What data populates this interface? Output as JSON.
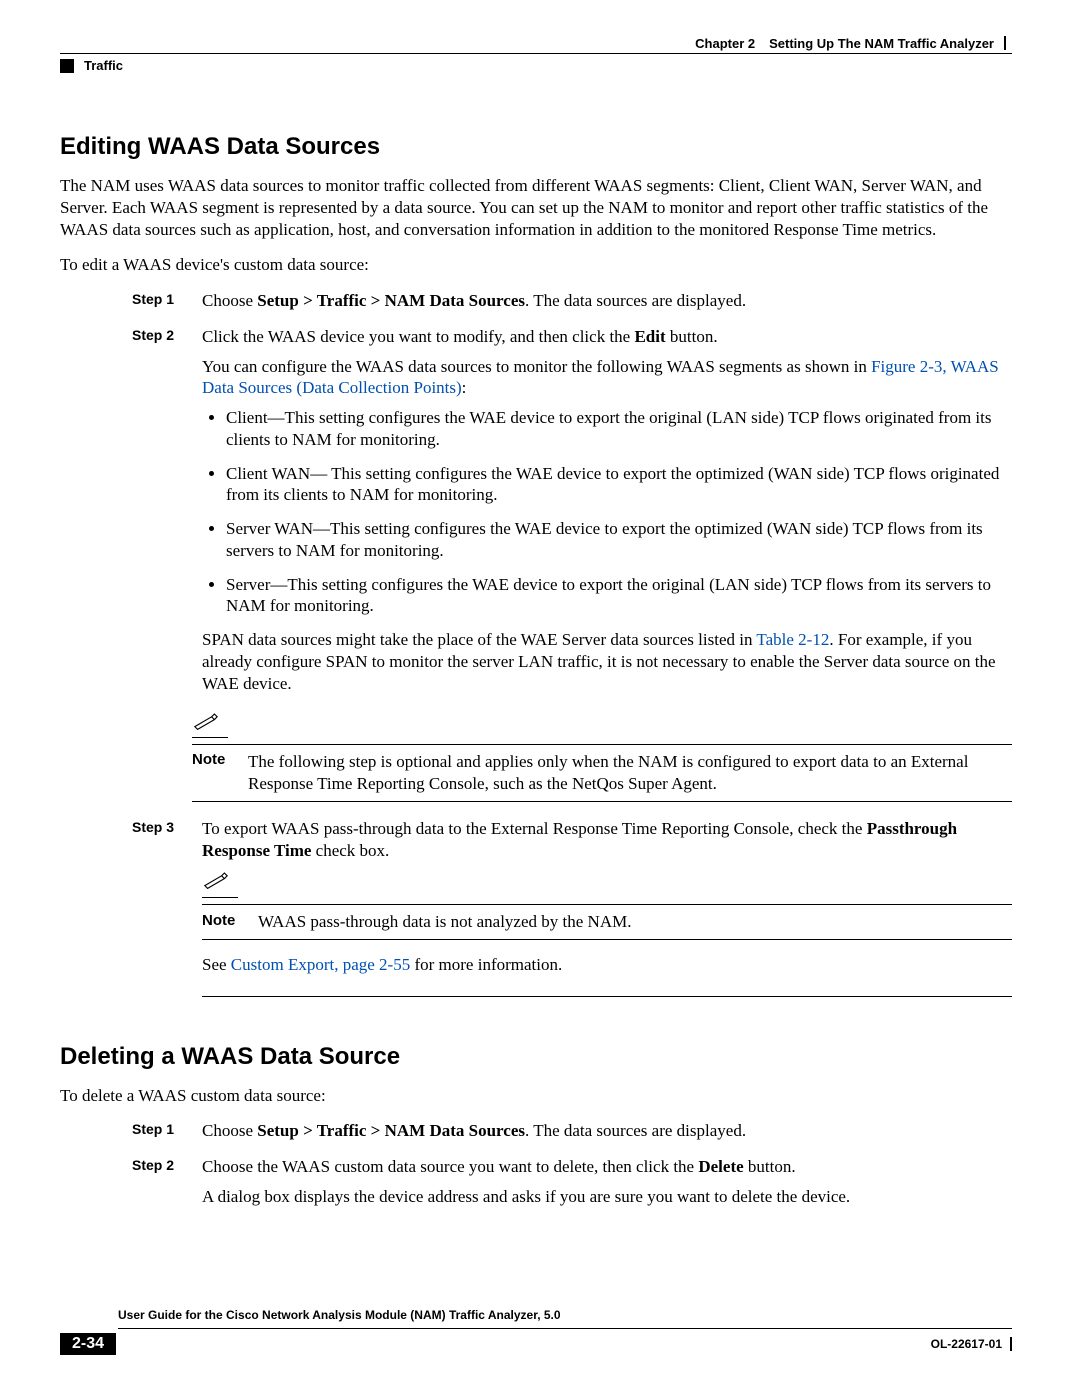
{
  "header": {
    "chapter": "Chapter 2",
    "title": "Setting Up The NAM Traffic Analyzer",
    "section": "Traffic"
  },
  "section1": {
    "title": "Editing WAAS Data Sources",
    "intro": "The NAM uses WAAS data sources to monitor traffic collected from different WAAS segments: Client, Client WAN, Server WAN, and Server. Each WAAS segment is represented by a data source. You can set up the NAM to monitor and report other traffic statistics of the WAAS data sources such as application, host, and conversation information in addition to the monitored Response Time metrics.",
    "intro2": "To edit a WAAS device's custom data source:",
    "steps": {
      "s1_label": "Step 1",
      "s1_pre": "Choose ",
      "s1_bold": "Setup > Traffic > NAM Data Sources",
      "s1_post": ". The data sources are displayed.",
      "s2_label": "Step 2",
      "s2_line1_pre": "Click the WAAS device you want to modify, and then click the ",
      "s2_line1_bold": "Edit",
      "s2_line1_post": " button.",
      "s2_line2": "You can configure the WAAS data sources to monitor the following WAAS segments as shown in ",
      "s2_link": "Figure 2-3, WAAS Data Sources (Data Collection Points)",
      "s2_link_post": ":",
      "segments": [
        "Client—This setting configures the WAE device to export the original (LAN side) TCP flows originated from its clients to NAM for monitoring.",
        "Client WAN— This setting configures the WAE device to export the optimized (WAN side) TCP flows originated from its clients to NAM for monitoring.",
        "Server WAN—This setting configures the WAE device to export the optimized (WAN side) TCP flows from its servers to NAM for monitoring.",
        "Server—This setting configures the WAE device to export the original (LAN side) TCP flows from its servers to NAM for monitoring."
      ],
      "span_pre": "SPAN data sources might take the place of the WAE Server data sources listed in ",
      "span_link": "Table 2-12",
      "span_post": ". For example, if you already configure SPAN to monitor the server LAN traffic, it is not necessary to enable the Server data source on the WAE device.",
      "note1_label": "Note",
      "note1_text": "The following step is optional and applies only when the NAM is configured to export data to an External Response Time Reporting Console, such as the NetQos Super Agent.",
      "s3_label": "Step 3",
      "s3_line1_pre": "To export WAAS pass-through data to the External Response Time Reporting Console, check the ",
      "s3_line1_bold": "Passthrough Response Time",
      "s3_line1_post": " check box.",
      "note2_label": "Note",
      "note2_text": "WAAS pass-through data is not analyzed by the NAM.",
      "s3_see_pre": "See ",
      "s3_see_link": "Custom Export, page 2-55",
      "s3_see_post": " for more information."
    }
  },
  "section2": {
    "title": "Deleting a WAAS Data Source",
    "intro": "To delete a WAAS custom data source:",
    "steps": {
      "s1_label": "Step 1",
      "s1_pre": "Choose ",
      "s1_bold": "Setup > Traffic > NAM Data Sources",
      "s1_post": ". The data sources are displayed.",
      "s2_label": "Step 2",
      "s2_pre": "Choose the WAAS custom data source you want to delete, then click the ",
      "s2_bold": "Delete",
      "s2_post": " button.",
      "s2_extra": "A dialog box displays the device address and asks if you are sure you want to delete the device."
    }
  },
  "footer": {
    "guide": "User Guide for the Cisco Network Analysis Module (NAM) Traffic Analyzer, 5.0",
    "page": "2-34",
    "code": "OL-22617-01"
  }
}
